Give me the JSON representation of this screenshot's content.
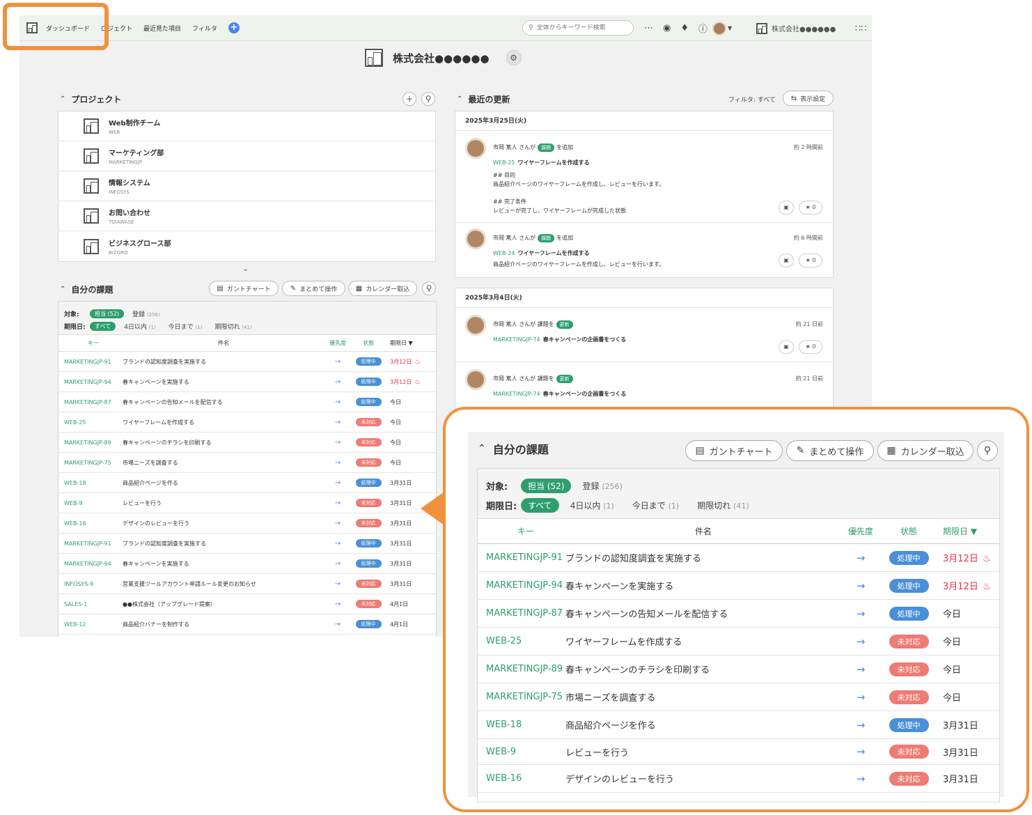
{
  "topbar": {
    "nav": [
      "ダッシュボード",
      "ロジェクト",
      "最近見た項目",
      "フィルタ"
    ],
    "add_icon": "plus-icon",
    "search_placeholder": "全体からキーワード検索",
    "company": "株式会社●●●●●●"
  },
  "space": {
    "name": "株式会社●●●●●●"
  },
  "projects": {
    "title": "プロジェクト",
    "items": [
      {
        "name": "Web制作チーム",
        "key": "WEB"
      },
      {
        "name": "マーケティング部",
        "key": "MARKETINGJP"
      },
      {
        "name": "情報システム",
        "key": "INFOSYS"
      },
      {
        "name": "お問い合わせ",
        "key": "TOIAWASE"
      },
      {
        "name": "ビジネスグロース部",
        "key": "BIZGRO"
      }
    ]
  },
  "my_issues": {
    "title": "自分の課題",
    "tools": {
      "gantt": "ガントチャート",
      "bulk": "まとめて操作",
      "calendar": "カレンダー取込"
    },
    "filter": {
      "target_label": "対象:",
      "assigned": "担当",
      "assigned_count": "(52)",
      "registered": "登録",
      "registered_count": "(256)",
      "due_label": "期限日:",
      "all": "すべて",
      "within4": "4日以内",
      "within4_count": "(1)",
      "today": "今日まで",
      "today_count": "(1)",
      "overdue": "期限切れ",
      "overdue_count": "(41)"
    },
    "columns": {
      "key": "キー",
      "name": "件名",
      "priority": "優先度",
      "status": "状態",
      "due": "期限日"
    },
    "rows": [
      {
        "key": "MARKETINGJP-91",
        "name": "ブランドの認知度調査を実施する",
        "status": "処理中",
        "due": "3月12日",
        "overdue": true
      },
      {
        "key": "MARKETINGJP-94",
        "name": "春キャンペーンを実施する",
        "status": "処理中",
        "due": "3月12日",
        "overdue": true
      },
      {
        "key": "MARKETINGJP-87",
        "name": "春キャンペーンの告知メールを配信する",
        "status": "処理中",
        "due": "今日",
        "overdue": false
      },
      {
        "key": "WEB-25",
        "name": "ワイヤーフレームを作成する",
        "status": "未対応",
        "due": "今日",
        "overdue": false
      },
      {
        "key": "MARKETINGJP-89",
        "name": "春キャンペーンのチラシを印刷する",
        "status": "未対応",
        "due": "今日",
        "overdue": false
      },
      {
        "key": "MARKETINGJP-75",
        "name": "市場ニーズを調査する",
        "status": "未対応",
        "due": "今日",
        "overdue": false
      },
      {
        "key": "WEB-18",
        "name": "商品紹介ページを作る",
        "status": "処理中",
        "due": "3月31日",
        "overdue": false
      },
      {
        "key": "WEB-9",
        "name": "レビューを行う",
        "status": "未対応",
        "due": "3月31日",
        "overdue": false
      },
      {
        "key": "WEB-16",
        "name": "デザインのレビューを行う",
        "status": "未対応",
        "due": "3月31日",
        "overdue": false
      },
      {
        "key": "MARKETINGJP-91",
        "name": "ブランドの認知度調査を実施する",
        "status": "処理中",
        "due": "3月31日",
        "overdue": false
      },
      {
        "key": "MARKETINGJP-94",
        "name": "春キャンペーンを実施する",
        "status": "処理中",
        "due": "3月31日",
        "overdue": false
      },
      {
        "key": "INFOSYS-9",
        "name": "営業支援ツールアカウント申請ルール変更のお知らせ",
        "status": "未対応",
        "due": "3月31日",
        "overdue": false
      },
      {
        "key": "SALES-1",
        "name": "●●株式会社（アップグレード提案）",
        "status": "未対応",
        "due": "4月1日",
        "overdue": false
      },
      {
        "key": "WEB-12",
        "name": "商品紹介バナーを制作する",
        "status": "処理中",
        "due": "4月1日",
        "overdue": false
      }
    ]
  },
  "recent": {
    "title": "最近の更新",
    "filter_label": "フィルタ: すべて",
    "display_settings": "表示設定",
    "groups": [
      {
        "date": "2025年3月25日(火)",
        "items": [
          {
            "user": "市岡 篤人 さんが",
            "tag": "課題",
            "action": "を追加",
            "time": "約 2 時間前",
            "key": "WEB-25",
            "title": "ワイヤーフレームを作成する",
            "lines": [
              "## 目的",
              "商品紹介ページのワイヤーフレームを作成し、レビューを行います。",
              "",
              "## 完了条件",
              "レビューが完了し、ワイヤーフレームが完成した状態"
            ],
            "stars": "0"
          },
          {
            "user": "市岡 篤人 さんが",
            "tag": "課題",
            "action": "を追加",
            "time": "約 6 時間前",
            "key": "WEB-24",
            "title": "ワイヤーフレームを作成する",
            "lines": [
              "商品紹介ページのワイヤーフレームを作成し、レビューを行います。"
            ],
            "stars": "0"
          }
        ]
      },
      {
        "date": "2025年3月4日(火)",
        "items": [
          {
            "user": "市岡 篤人 さんが 課題を",
            "tag": "更新",
            "action": "",
            "time": "約 21 日前",
            "key": "MARKETINGJP-74",
            "title": "春キャンペーンの企画書をつくる",
            "lines": [],
            "stars": "0"
          },
          {
            "user": "市岡 篤人 さんが 課題を",
            "tag": "更新",
            "action": "",
            "time": "約 21 日前",
            "key": "MARKETINGJP-74",
            "title": "春キャンペーンの企画書をつくる",
            "lines": [],
            "stars": "0"
          }
        ]
      }
    ]
  },
  "colors": {
    "accent": "#2e9e6e",
    "highlight": "#f0923c",
    "in_progress": "#4a8fd8",
    "open": "#ee7b74",
    "overdue": "#e0334a"
  }
}
